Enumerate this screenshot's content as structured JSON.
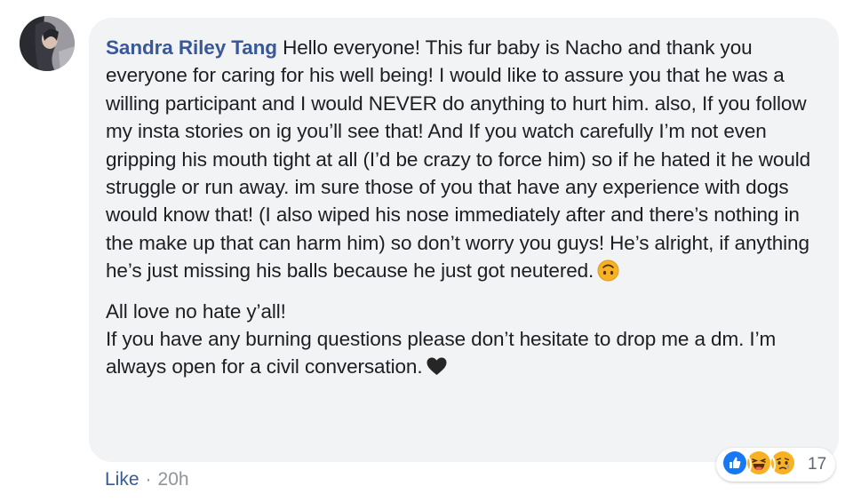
{
  "comment": {
    "author": "Sandra Riley Tang",
    "paragraph1": "Hello everyone! This fur baby is Nacho and thank you everyone for caring for his well being! I would like to assure you that he was a willing participant and I would NEVER do anything to hurt him. also, If you follow my insta stories on ig you’ll see that! And If you watch carefully I’m not even gripping his mouth tight at all (I’d be crazy to force him) so if he hated it he would struggle or run away. im sure those of you that have any experience with dogs would know that! (I also wiped his nose immediately after and there’s nothing in the make up that can harm him) so don’t worry you guys! He’s alright, if anything he’s just missing his balls because he just got neutered.",
    "paragraph2_line1": "All love no hate y’all!",
    "paragraph2_line2": "If you have any burning questions please don’t hesitate to drop me a dm. I’m always open for a civil conversation.",
    "emoji1": "upside-down-face-icon",
    "emoji2": "black-heart-icon"
  },
  "reactions": {
    "icons": [
      "like-icon",
      "haha-icon",
      "sad-icon"
    ],
    "count": "17"
  },
  "meta": {
    "like_label": "Like",
    "separator": "·",
    "timestamp": "20h"
  },
  "colors": {
    "author": "#385898",
    "bubble": "#f2f3f5",
    "meta": "#90949c",
    "like": "#1877f2",
    "haha": "#f7b125"
  }
}
